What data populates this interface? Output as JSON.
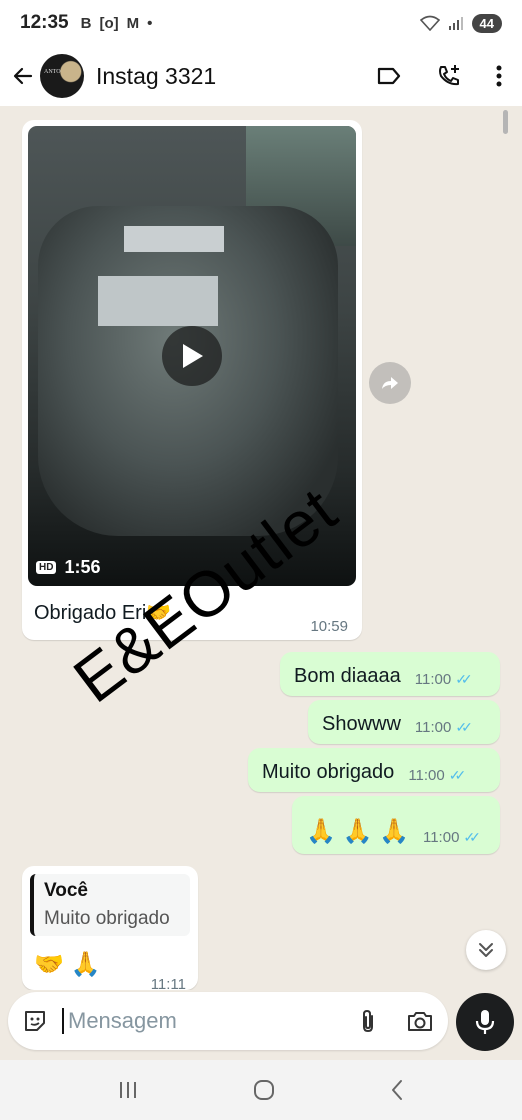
{
  "status_bar": {
    "time": "12:35",
    "indicators": [
      "B",
      "[o]",
      "M",
      "•"
    ],
    "battery": "44"
  },
  "header": {
    "contact_name": "Instag 3321",
    "avatar_text": "ANTO"
  },
  "messages": {
    "video": {
      "duration": "1:56",
      "hd_label": "HD",
      "caption": "Obrigado Eri🤝",
      "time": "10:59"
    },
    "outgoing": [
      {
        "text": "Bom diaaaa",
        "time": "11:00"
      },
      {
        "text": "Showww",
        "time": "11:00"
      },
      {
        "text": "Muito obrigado",
        "time": "11:00"
      },
      {
        "text": "🙏 🙏 🙏",
        "time": "11:00"
      }
    ],
    "reply": {
      "quote_author": "Você",
      "quote_text": "Muito obrigado",
      "text": "🤝 🙏",
      "time": "11:11"
    }
  },
  "watermark": "E&EOutlet",
  "composer": {
    "placeholder": "Mensagem"
  },
  "colors": {
    "outgoing_bubble": "#d9fdd3",
    "incoming_bubble": "#ffffff",
    "chat_background": "#efeae2",
    "read_ticks": "#53bdeb",
    "mic_button": "#1c1e1f"
  }
}
